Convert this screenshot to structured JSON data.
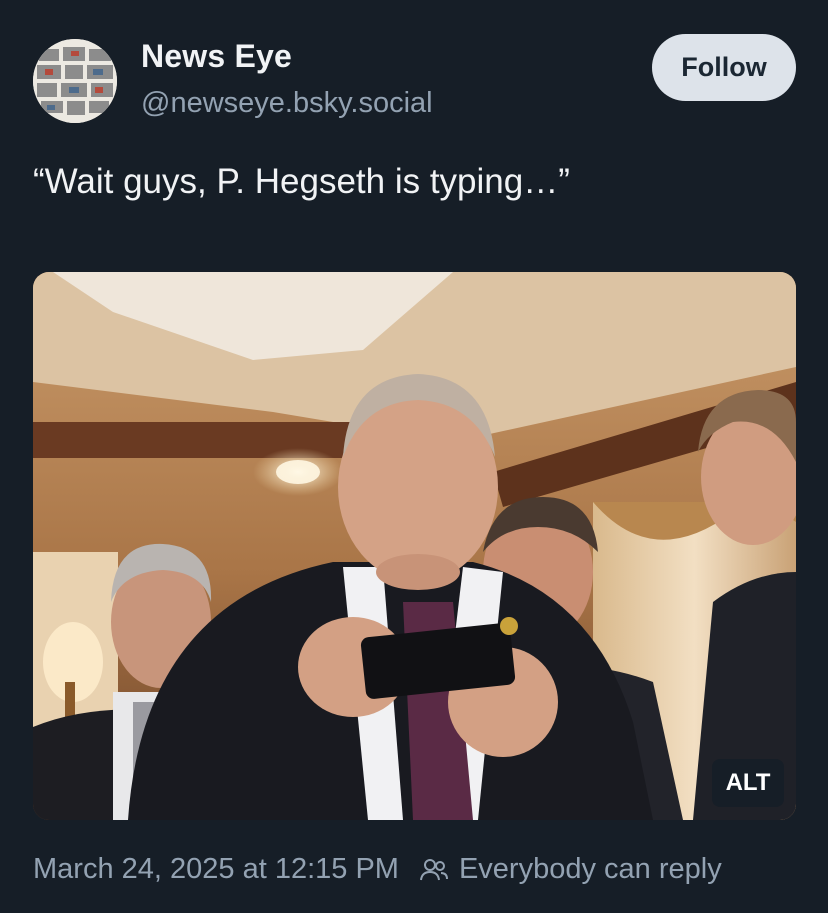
{
  "post": {
    "author": {
      "display_name": "News Eye",
      "handle": "@newseye.bsky.social"
    },
    "follow_label": "Follow",
    "text": "“Wait guys, P. Hegseth is typing…”",
    "image": {
      "alt_badge": "ALT",
      "icon": "photo"
    },
    "timestamp": "March 24, 2025 at 12:15 PM",
    "reply_setting": {
      "icon": "people-icon",
      "label": "Everybody can reply"
    }
  },
  "colors": {
    "background": "#161e27",
    "primary_text": "#f1f3f5",
    "secondary_text": "#93a2b2",
    "follow_button_bg": "#dde3ea",
    "follow_button_text": "#1b2733"
  }
}
